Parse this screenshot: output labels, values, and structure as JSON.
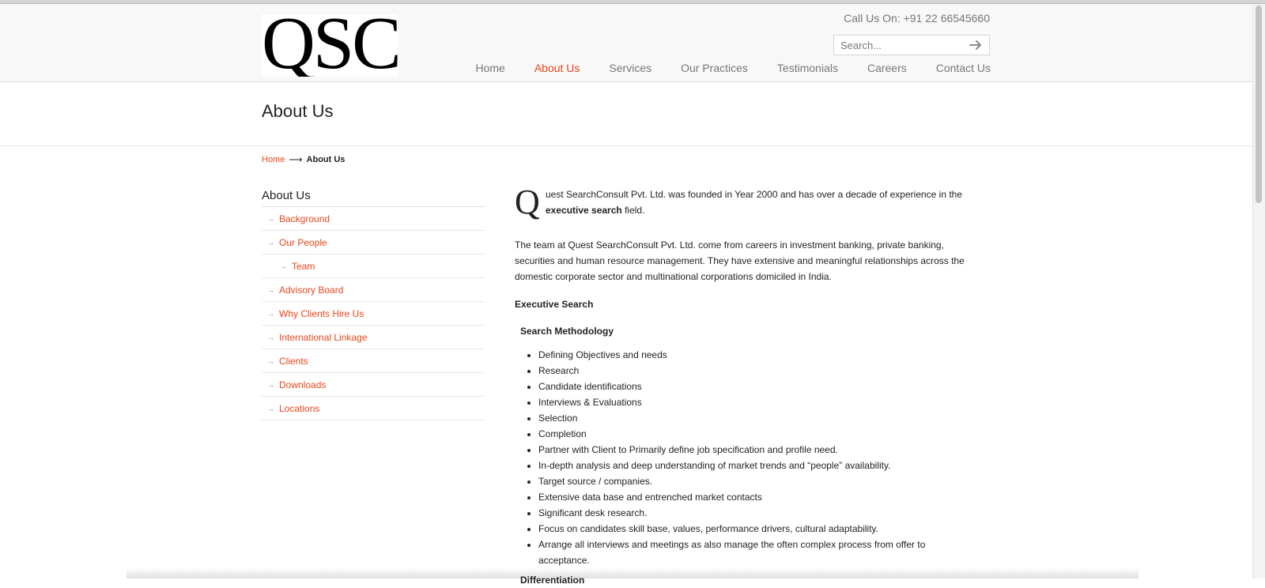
{
  "header": {
    "logo_text": "QSC",
    "call_us": "Call Us On: +91 22 66545660",
    "search": {
      "placeholder": "Search...",
      "go_icon": "arrow-right-icon"
    },
    "nav": [
      {
        "label": "Home",
        "active": false
      },
      {
        "label": "About Us",
        "active": true
      },
      {
        "label": "Services",
        "active": false
      },
      {
        "label": "Our Practices",
        "active": false
      },
      {
        "label": "Testimonials",
        "active": false
      },
      {
        "label": "Careers",
        "active": false
      },
      {
        "label": "Contact Us",
        "active": false
      }
    ]
  },
  "page_title": "About Us",
  "breadcrumb": {
    "home": "Home",
    "separator": "⟶",
    "current": "About Us"
  },
  "sidebar": {
    "title": "About Us",
    "arrow": "→",
    "items": [
      {
        "label": "Background",
        "sub": false
      },
      {
        "label": "Our People",
        "sub": false
      },
      {
        "label": "Team",
        "sub": true
      },
      {
        "label": "Advisory Board",
        "sub": false
      },
      {
        "label": "Why Clients Hire Us",
        "sub": false
      },
      {
        "label": "International Linkage",
        "sub": false
      },
      {
        "label": "Clients",
        "sub": false
      },
      {
        "label": "Downloads",
        "sub": false
      },
      {
        "label": "Locations",
        "sub": false
      }
    ]
  },
  "content": {
    "dropcap": "Q",
    "intro_text": "uest SearchConsult Pvt. Ltd. was founded in Year 2000 and has over a decade of experience in the ",
    "intro_bold": "executive search",
    "intro_tail": " field.",
    "team_para": "The team at Quest SearchConsult Pvt. Ltd. come from careers in investment banking, private banking, securities and human resource management. They have extensive and meaningful relationships across the domestic corporate sector and multinational corporations domiciled in India.",
    "exec_heading": "Executive Search",
    "method_heading": "Search Methodology",
    "bullets": [
      "Defining Objectives and needs",
      "Research",
      "Candidate identifications",
      "Interviews & Evaluations",
      "Selection",
      "Completion",
      "Partner with Client to Primarily define job specification and profile need.",
      "In-depth analysis and deep understanding of market trends and “people” availability.",
      "Target source / companies.",
      "Extensive data base and entrenched market contacts",
      "Significant desk research.",
      "Focus on candidates skill base, values, performance drivers, cultural adaptability.",
      "Arrange all interviews and meetings as also manage the often complex process from offer to acceptance."
    ],
    "diff_heading": "Differentiation"
  },
  "colors": {
    "accent": "#e8461c",
    "nav_text": "#777777",
    "header_bg": "#f8f8f8"
  }
}
